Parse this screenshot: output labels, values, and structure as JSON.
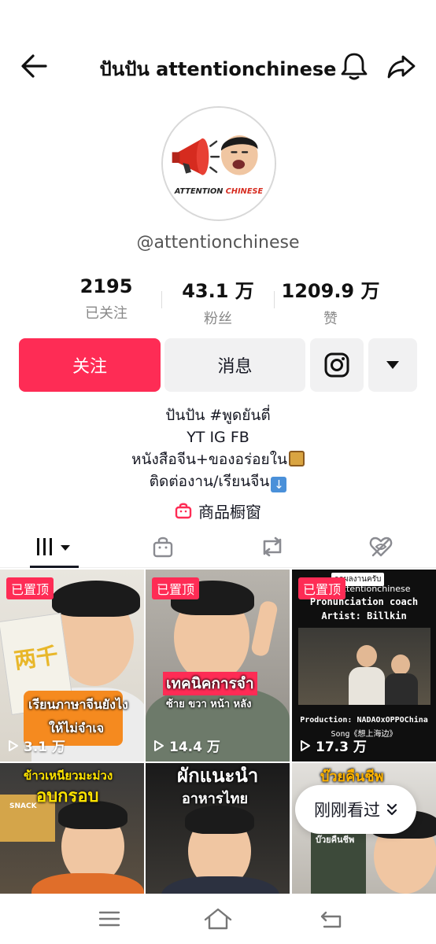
{
  "header": {
    "title": "ปันปัน attentionchinese",
    "back_icon": "arrow-left-icon",
    "bell_icon": "bell-icon",
    "share_icon": "share-icon"
  },
  "profile": {
    "avatar_label_1": "ATTENTION",
    "avatar_label_2": "CHINESE",
    "handle": "@attentionchinese"
  },
  "stats": [
    {
      "value": "2195",
      "label": "已关注"
    },
    {
      "value": "43.1 万",
      "label": "粉丝"
    },
    {
      "value": "1209.9 万",
      "label": "赞"
    }
  ],
  "actions": {
    "follow_label": "关注",
    "message_label": "消息",
    "instagram_icon": "instagram-icon",
    "more_icon": "chevron-down-icon"
  },
  "bio": {
    "line1": "ปันปัน #พูดยันตี่",
    "line2": "YT IG FB",
    "line3": "หนังสือจีน+ของอร่อยใน",
    "line4": "ติดต่องาน/เรียนจีน"
  },
  "shop": {
    "label": "商品橱窗",
    "icon": "shopping-bag-icon"
  },
  "tabs": [
    {
      "name": "videos",
      "icon": "grid-icon"
    },
    {
      "name": "shop",
      "icon": "bag-icon"
    },
    {
      "name": "reposts",
      "icon": "repost-icon"
    },
    {
      "name": "liked",
      "icon": "heart-hidden-icon"
    }
  ],
  "videos": [
    {
      "pinned": "已置顶",
      "views": "3.1 万",
      "caption1": "เรียนภาษาจีนยังไง",
      "caption2": "ให้ไม่จำเจ",
      "book_text": "两千"
    },
    {
      "pinned": "已置顶",
      "views": "14.4 万",
      "caption1": "เทคนิคการจำ",
      "caption2": "ซ้าย ขวา หน้า หลัง"
    },
    {
      "pinned": "已置顶",
      "views": "17.3 万",
      "caption1": "Pronunciation coach",
      "caption2": "Artist: Billkin",
      "caption3": "Production: NADAOxOPPOChina",
      "caption4": "Song《想上海边》",
      "tag": "attentionchinese",
      "tag_top": "ากผลงานครับ"
    },
    {
      "caption1": "ข้าวเหนียวมะม่วง",
      "caption2": "อบกรอบ",
      "sign": "SNACK"
    },
    {
      "caption1": "ผักแนะนำ",
      "caption2": "อาหารไทย"
    },
    {
      "caption1": "บ๊วยคืนชีพ",
      "caption2": "บ๊วยคืนชีพ"
    }
  ],
  "recently_viewed": {
    "label": "刚刚看过",
    "icon": "double-chevron-down-icon"
  },
  "system_nav": {
    "menu_icon": "menu-icon",
    "home_icon": "home-icon",
    "back_icon": "back-icon"
  },
  "colors": {
    "accent": "#fe2c55",
    "button_gray": "#f1f1f2",
    "text": "#161823"
  }
}
